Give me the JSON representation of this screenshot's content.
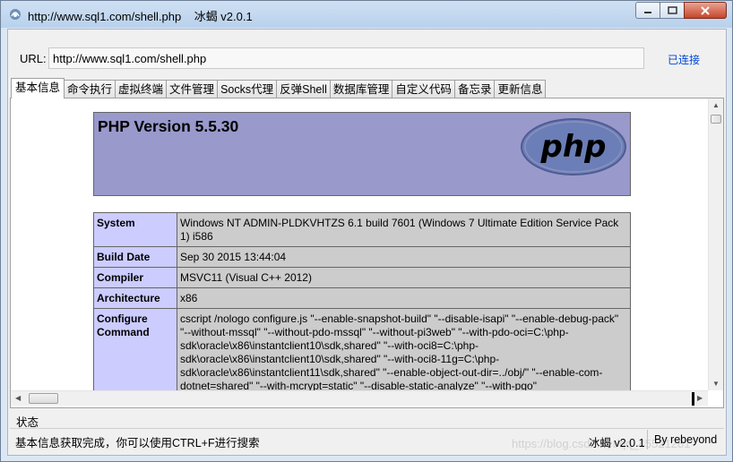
{
  "window": {
    "title": "http://www.sql1.com/shell.php    冰蝎 v2.0.1",
    "icon": "ice-scorpion-icon"
  },
  "connection": {
    "url_label": "URL:",
    "url_value": "http://www.sql1.com/shell.php",
    "status": "已连接"
  },
  "tabs": [
    {
      "label": "基本信息",
      "active": true
    },
    {
      "label": "命令执行"
    },
    {
      "label": "虚拟终端"
    },
    {
      "label": "文件管理"
    },
    {
      "label": "Socks代理"
    },
    {
      "label": "反弹Shell"
    },
    {
      "label": "数据库管理"
    },
    {
      "label": "自定义代码"
    },
    {
      "label": "备忘录"
    },
    {
      "label": "更新信息"
    }
  ],
  "phpinfo": {
    "version_title": "PHP Version 5.5.30",
    "logo_text": "php",
    "rows": [
      {
        "key": "System",
        "value": "Windows NT ADMIN-PLDKVHTZS 6.1 build 7601 (Windows 7 Ultimate Edition Service Pack 1) i586"
      },
      {
        "key": "Build Date",
        "value": "Sep 30 2015 13:44:04"
      },
      {
        "key": "Compiler",
        "value": "MSVC11 (Visual C++ 2012)"
      },
      {
        "key": "Architecture",
        "value": "x86"
      },
      {
        "key": "Configure Command",
        "value": "cscript /nologo configure.js \"--enable-snapshot-build\" \"--disable-isapi\" \"--enable-debug-pack\" \"--without-mssql\" \"--without-pdo-mssql\" \"--without-pi3web\" \"--with-pdo-oci=C:\\php-sdk\\oracle\\x86\\instantclient10\\sdk,shared\" \"--with-oci8=C:\\php-sdk\\oracle\\x86\\instantclient10\\sdk,shared\" \"--with-oci8-11g=C:\\php-sdk\\oracle\\x86\\instantclient11\\sdk,shared\" \"--enable-object-out-dir=../obj/\" \"--enable-com-dotnet=shared\" \"--with-mcrypt=static\" \"--disable-static-analyze\" \"--with-pgo\""
      }
    ]
  },
  "status_bar": {
    "label": "状态",
    "message": "基本信息获取完成，你可以使用CTRL+F进行搜索",
    "version": "冰蝎 v2.0.1",
    "author": "By rebeyond"
  },
  "watermark": "https://blog.csdn.net/qq_45521281",
  "colors": {
    "php_header_bg": "#9999cc",
    "php_key_bg": "#ccccff",
    "php_value_bg": "#cccccc",
    "status_link": "#0046d5"
  }
}
